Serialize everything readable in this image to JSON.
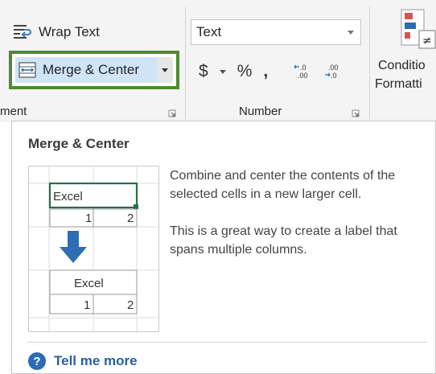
{
  "ribbon": {
    "wrap_text_label": "Wrap Text",
    "merge_center_label": "Merge & Center",
    "alignment_group_label": "ment",
    "number_format_value": "Text",
    "currency_symbol": "$",
    "percent_symbol": "%",
    "comma_symbol": ",",
    "number_group_label": "Number",
    "conditional_label_line1": "Conditio",
    "conditional_label_line2": "Formatti",
    "accent_color": "#4e8b30",
    "highlight_color": "#cfe4f7"
  },
  "tooltip": {
    "title": "Merge & Center",
    "description_1": "Combine and center the contents of the selected cells in a new larger cell.",
    "description_2": "This is a great way to create a label that spans multiple columns.",
    "tell_me_more": "Tell me more",
    "help_icon_char": "?",
    "illustration": {
      "before_label": "Excel",
      "before_cell_1": "1",
      "before_cell_2": "2",
      "after_label": "Excel",
      "after_cell_1": "1",
      "after_cell_2": "2"
    }
  }
}
